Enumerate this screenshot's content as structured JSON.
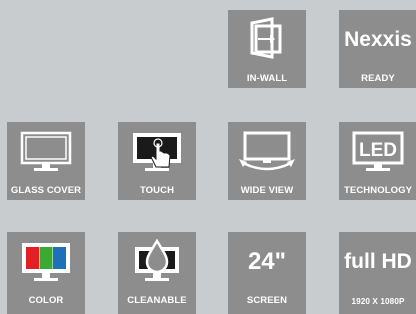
{
  "tiles": {
    "in_wall": {
      "label": "IN-WALL",
      "icon": "in-wall-icon"
    },
    "ready": {
      "label": "READY",
      "brand": "Nexxis"
    },
    "glass_cover": {
      "label": "GLASS COVER",
      "icon": "glass-cover-monitor-icon"
    },
    "touch": {
      "label": "TOUCH",
      "icon": "touch-monitor-icon"
    },
    "wide_view": {
      "label": "WIDE VIEW",
      "icon": "wide-view-monitor-icon"
    },
    "technology": {
      "label": "TECHNOLOGY",
      "text": "LED"
    },
    "color": {
      "label": "COLOR",
      "icon": "color-bars-monitor-icon"
    },
    "cleanable": {
      "label": "CLEANABLE",
      "icon": "droplet-monitor-icon"
    },
    "screen": {
      "label": "SCREEN",
      "size": "24\""
    },
    "resolution": {
      "label": "1920 X 1080P",
      "text": "full HD"
    }
  },
  "colors": {
    "background": "#c9ccce",
    "tile": "#8d8d8d",
    "foreground": "#ffffff",
    "bar_red": "#e31e24",
    "bar_green": "#3aaa35",
    "bar_blue": "#1d71b8"
  }
}
